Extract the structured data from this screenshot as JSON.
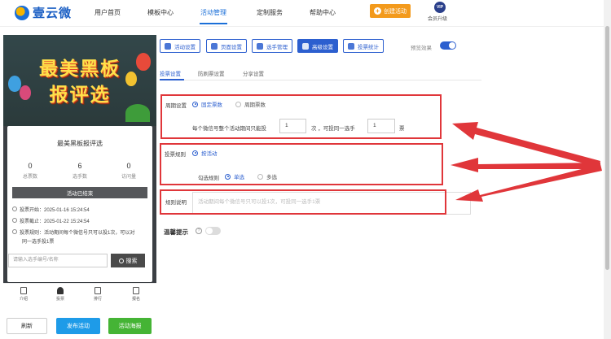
{
  "header": {
    "logo_text": "壹云微",
    "nav": [
      "用户首页",
      "模板中心",
      "活动管理",
      "定制服务",
      "帮助中心"
    ],
    "create_label": "创建活动",
    "vip_badge": "VIP",
    "vip_label": "会员升级"
  },
  "preview": {
    "banner_line1": "最美黑板",
    "banner_line2": "报评选",
    "card_title": "最美黑板报评选",
    "stats": [
      {
        "num": "0",
        "label": "总票数"
      },
      {
        "num": "6",
        "label": "选手数"
      },
      {
        "num": "0",
        "label": "访问量"
      }
    ],
    "ended_label": "活动已结束",
    "vote_start": "投票开始：2025-01-16 15:24:54",
    "vote_end": "投票截止：2025-01-22 15:24:54",
    "vote_rule_line1": "投票规则：活动期间每个微信号只可以投1次，可以对",
    "vote_rule_line2": "同一选手投1票",
    "search_placeholder": "请输入选手编号/名称",
    "search_button": "搜索",
    "tabs": [
      "介绍",
      "投票",
      "排行",
      "报名"
    ]
  },
  "actions": {
    "refresh": "刷新",
    "publish": "发布活动",
    "poster": "活动海报"
  },
  "toolbar": {
    "buttons": [
      "活动设置",
      "页面设置",
      "选手管理",
      "高级设置",
      "投票统计"
    ],
    "preview_label": "预览效果"
  },
  "subtabs": [
    "投票设置",
    "防刷票设置",
    "分享设置"
  ],
  "form": {
    "cycle_label": "周期设置",
    "cycle_options": [
      "固定票数",
      "周期票数"
    ],
    "cycle_text_a": "每个微信号整个活动期间只能投",
    "cycle_value_a": "1",
    "cycle_text_b": "次  ，可投同一选手",
    "cycle_value_b": "1",
    "cycle_text_c": "票",
    "rule_label": "投票规则",
    "rule_option": "按活动",
    "select_label": "勾选规则",
    "select_options": [
      "单选",
      "多选"
    ],
    "desc_label": "规则说明",
    "desc_text": "活动期间每个微信号只可以投1次，可投同一选手1票",
    "tip_label": "温馨提示",
    "tip_help": "?"
  },
  "colors": {
    "accent": "#2c5fcf",
    "create": "#f39a1c",
    "publish": "#1e9be8",
    "poster": "#45b435",
    "highlight": "#e0363a"
  }
}
